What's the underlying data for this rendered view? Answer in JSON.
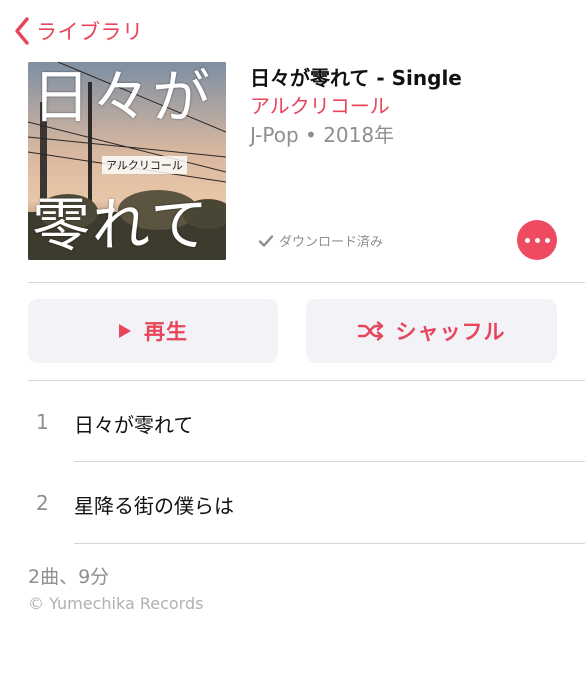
{
  "nav": {
    "back_label": "ライブラリ"
  },
  "album": {
    "art_text_top": "日々が",
    "art_text_bottom": "零れて",
    "art_artist": "アルクリコール",
    "title": "日々が零れて - Single",
    "artist": "アルクリコール",
    "meta": "J-Pop • 2018年",
    "download_status": "ダウンロード済み"
  },
  "actions": {
    "play_label": "再生",
    "shuffle_label": "シャッフル"
  },
  "tracks": [
    {
      "number": "1",
      "title": "日々が零れて"
    },
    {
      "number": "2",
      "title": "星降る街の僕らは"
    }
  ],
  "footer": {
    "summary": "2曲、9分",
    "copyright": "© Yumechika Records"
  },
  "colors": {
    "accent": "#e8455b",
    "secondary_text": "#8e8e93",
    "button_bg": "#f2f2f7"
  },
  "icons": [
    "chevron-left-icon",
    "checkmark-icon",
    "more-icon",
    "play-icon",
    "shuffle-icon"
  ]
}
